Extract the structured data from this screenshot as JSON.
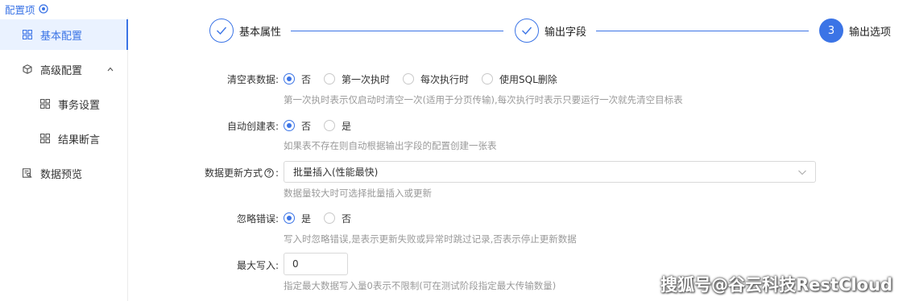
{
  "sidebar": {
    "title": "配置项",
    "items": [
      {
        "label": "基本配置",
        "icon": "grid-icon"
      },
      {
        "label": "高级配置",
        "icon": "cube-icon"
      },
      {
        "label": "事务设置",
        "icon": "grid-icon"
      },
      {
        "label": "结果断言",
        "icon": "grid-icon"
      },
      {
        "label": "数据预览",
        "icon": "preview-icon"
      }
    ]
  },
  "steps": [
    {
      "label": "基本属性",
      "state": "done"
    },
    {
      "label": "输出字段",
      "state": "done"
    },
    {
      "number": "3",
      "label": "输出选项",
      "state": "current"
    }
  ],
  "form": {
    "clear_table": {
      "label": "清空表数据:",
      "options": [
        "否",
        "第一次执时",
        "每次执行时",
        "使用SQL删除"
      ],
      "selected": "否",
      "help": "第一次执时表示仅启动时清空一次(适用于分页传输),每次执行时表示只要运行一次就先清空目标表"
    },
    "auto_create": {
      "label": "自动创建表:",
      "options": [
        "否",
        "是"
      ],
      "selected": "否",
      "help": "如果表不存在则自动根据输出字段的配置创建一张表"
    },
    "update_mode": {
      "label": "数据更新方式",
      "value": "批量插入(性能最快)",
      "help": "数据量较大时可选择批量插入或更新"
    },
    "ignore_errors": {
      "label": "忽略错误:",
      "options": [
        "是",
        "否"
      ],
      "selected": "是",
      "help": "写入时忽略错误,是表示更新失败或异常时跳过记录,否表示停止更新数据"
    },
    "max_write": {
      "label": "最大写入:",
      "value": "0",
      "help": "指定最大数据写入量0表示不限制(可在测试阶段指定最大传输数量)"
    }
  },
  "watermark": "搜狐号@谷云科技RestCloud",
  "colors": {
    "accent": "#3b74e6",
    "active_bg": "#eaf2ff",
    "help_text": "#999999"
  }
}
